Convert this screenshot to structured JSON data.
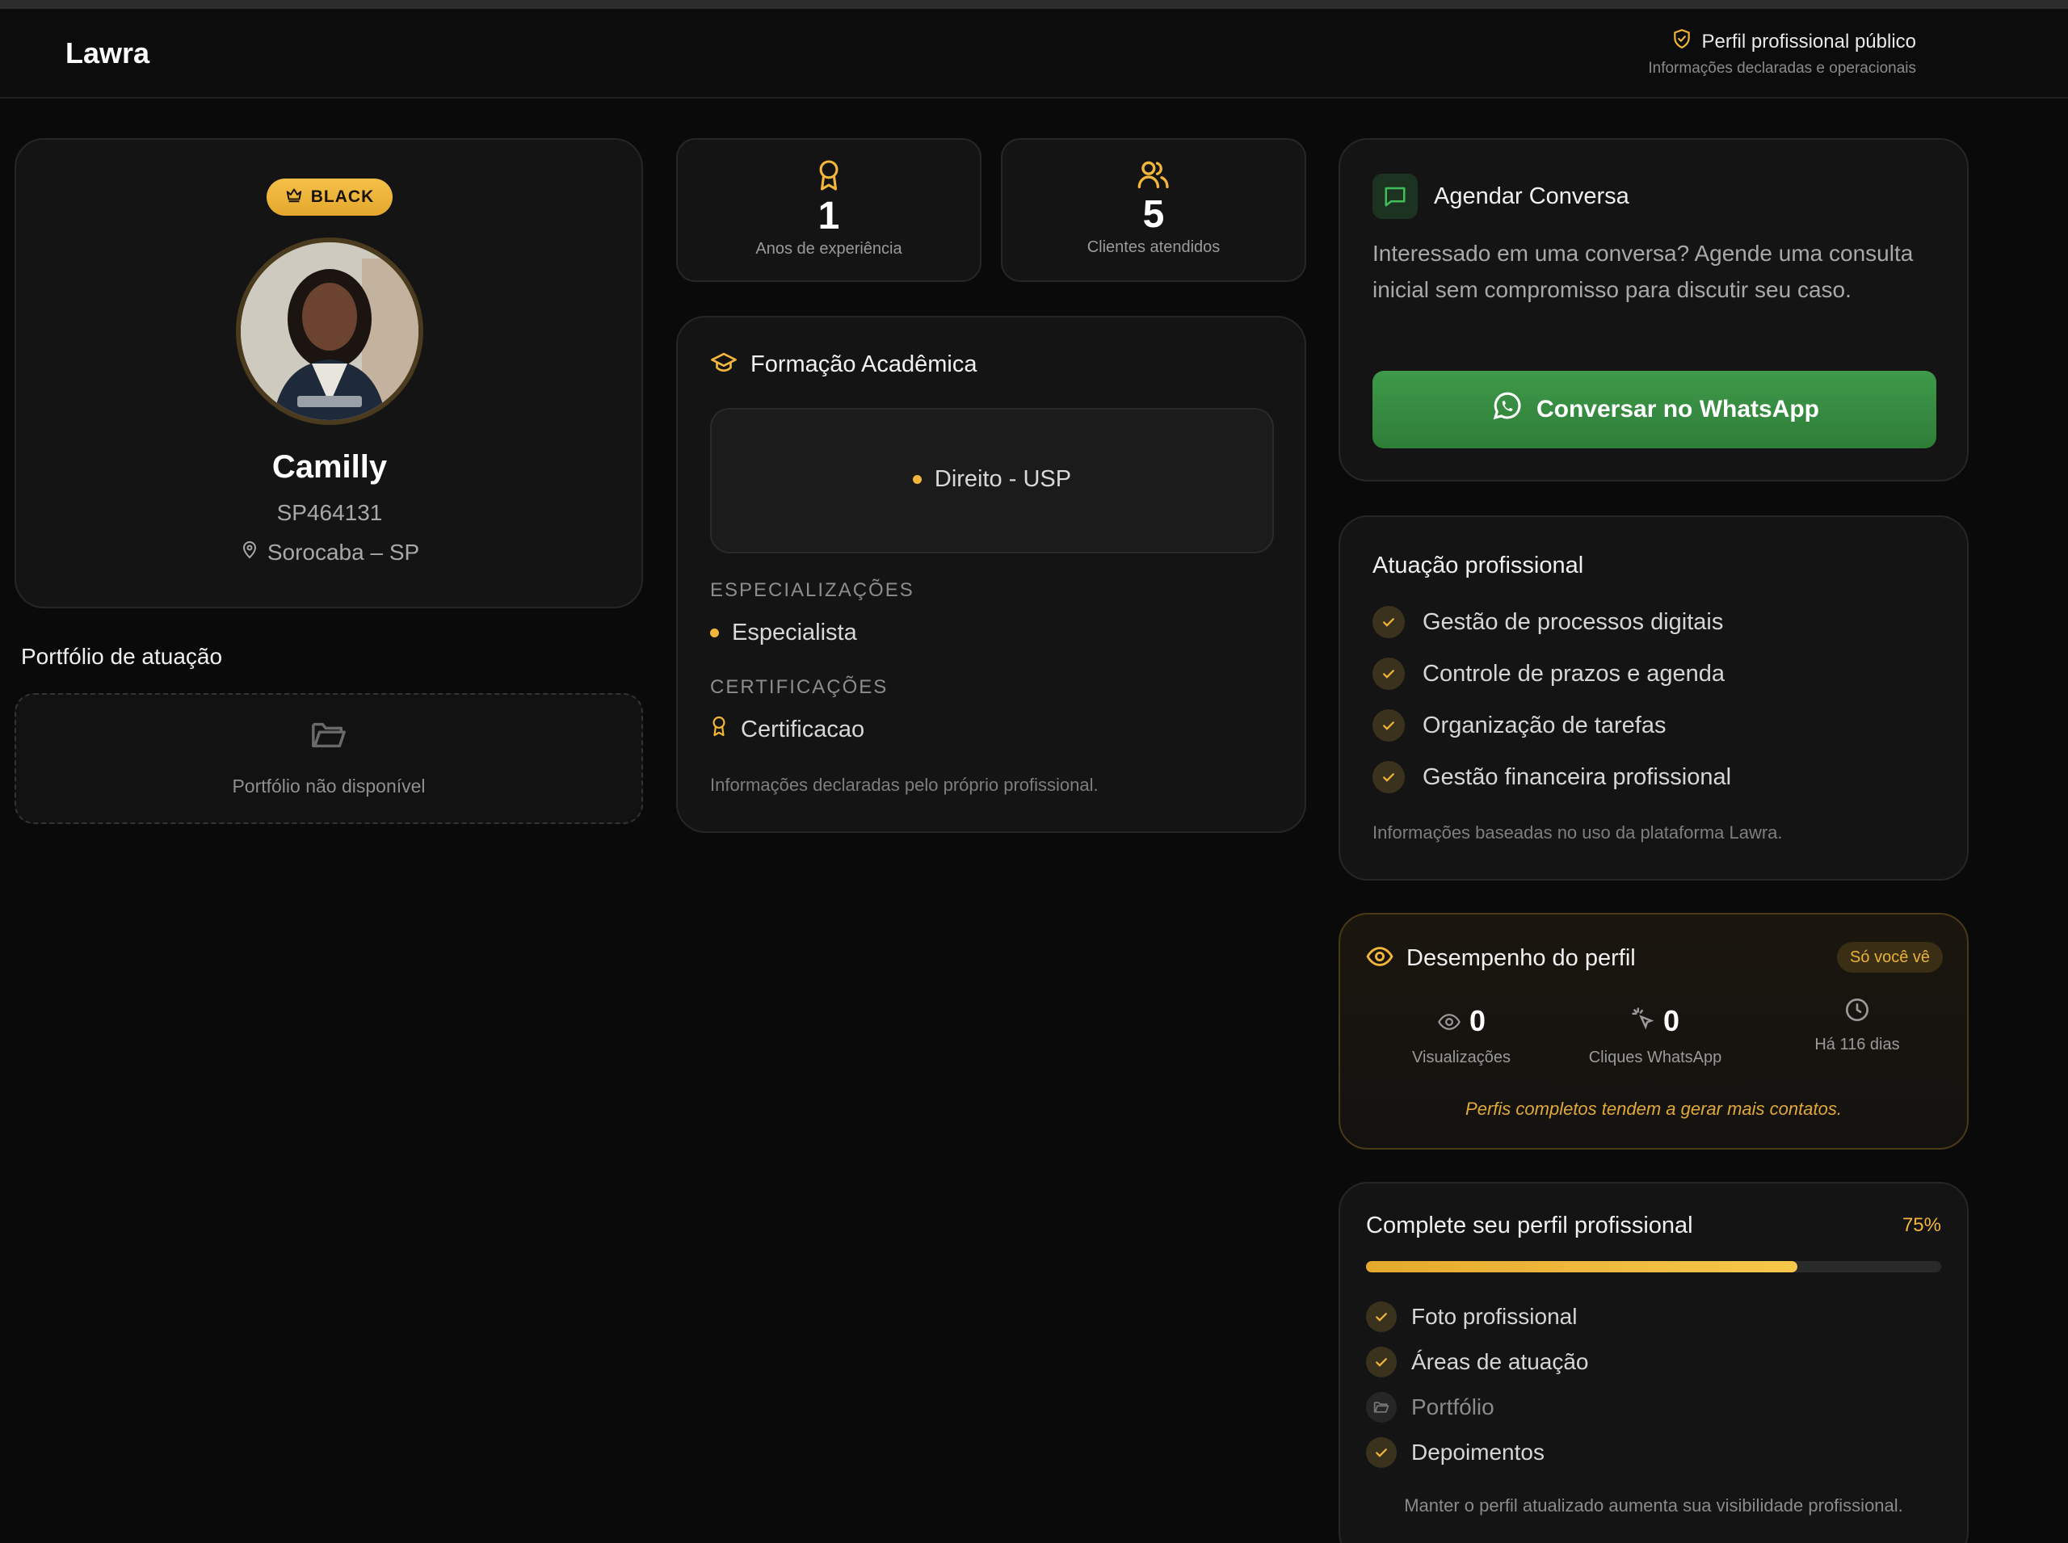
{
  "header": {
    "brand": "Lawra",
    "public_label": "Perfil profissional público",
    "public_sub": "Informações declaradas e operacionais"
  },
  "profile": {
    "badge": "BLACK",
    "name": "Camilly",
    "oab": "SP464131",
    "location": "Sorocaba – SP"
  },
  "portfolio": {
    "title": "Portfólio de atuação",
    "empty": "Portfólio não disponível"
  },
  "stats": [
    {
      "value": "1",
      "label": "Anos de experiência",
      "icon": "award-icon"
    },
    {
      "value": "5",
      "label": "Clientes atendidos",
      "icon": "users-icon"
    }
  ],
  "education": {
    "title": "Formação Acadêmica",
    "degree": "Direito - USP",
    "spec_title": "ESPECIALIZAÇÕES",
    "spec": "Especialista",
    "cert_title": "CERTIFICAÇÕES",
    "cert": "Certificacao",
    "footnote": "Informações declaradas pelo próprio profissional."
  },
  "schedule": {
    "title": "Agendar Conversa",
    "text": "Interessado em uma conversa? Agende uma consulta inicial sem compromisso para discutir seu caso.",
    "button": "Conversar no WhatsApp"
  },
  "activity": {
    "title": "Atuação profissional",
    "items": [
      "Gestão de processos digitais",
      "Controle de prazos e agenda",
      "Organização de tarefas",
      "Gestão financeira profissional"
    ],
    "footnote": "Informações baseadas no uso da plataforma Lawra."
  },
  "performance": {
    "title": "Desempenho do perfil",
    "pill": "Só você vê",
    "views": "0",
    "views_label": "Visualizações",
    "clicks": "0",
    "clicks_label": "Cliques WhatsApp",
    "since_label": "Há 116 dias",
    "tip": "Perfis completos tendem a gerar mais contatos."
  },
  "complete": {
    "title": "Complete seu perfil profissional",
    "percent_label": "75%",
    "progress": 0.75,
    "items": [
      {
        "label": "Foto profissional",
        "done": true
      },
      {
        "label": "Áreas de atuação",
        "done": true
      },
      {
        "label": "Portfólio",
        "done": false
      },
      {
        "label": "Depoimentos",
        "done": true
      }
    ],
    "footnote": "Manter o perfil atualizado aumenta sua visibilidade profissional."
  },
  "colors": {
    "accent": "#f2b63a",
    "whatsapp": "#3a8f45",
    "background": "#0a0a0a"
  }
}
